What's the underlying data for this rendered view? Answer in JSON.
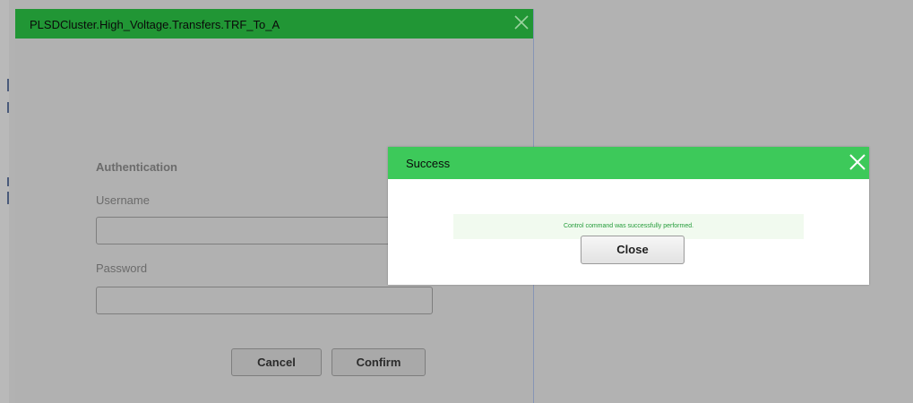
{
  "background_window": {
    "title": "PLSDCluster.High_Voltage.Transfers.TRF_To_A",
    "close_icon": "close-x-icon",
    "header_color": "#219635"
  },
  "auth_form": {
    "heading": "Authentication",
    "username_label": "Username",
    "username_value": "",
    "password_label": "Password",
    "password_value": "",
    "cancel_label": "Cancel",
    "confirm_label": "Confirm"
  },
  "success_modal": {
    "title": "Success",
    "close_icon": "close-x-icon",
    "header_color": "#3dc95a",
    "message": "Control command was successfully performed.",
    "message_color": "#249c3a",
    "close_button_label": "Close"
  }
}
